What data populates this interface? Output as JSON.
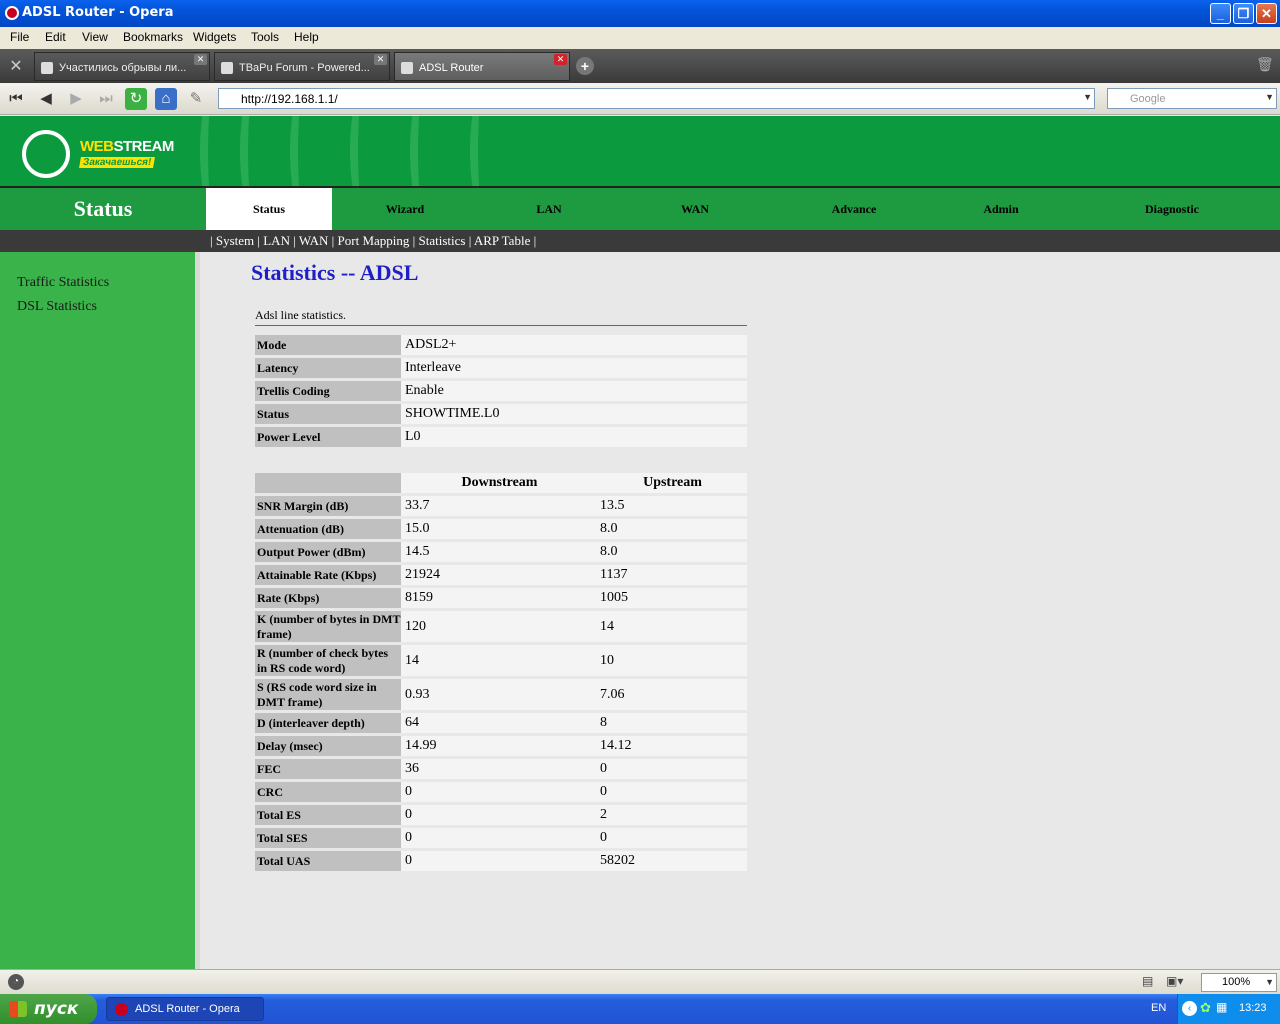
{
  "window": {
    "title": "ADSL Router - Opera"
  },
  "menu": [
    "File",
    "Edit",
    "View",
    "Bookmarks",
    "Widgets",
    "Tools",
    "Help"
  ],
  "tabs": [
    {
      "label": "Участились обрывы ли..."
    },
    {
      "label": "TBaPu Forum - Powered..."
    },
    {
      "label": "ADSL Router"
    }
  ],
  "address": {
    "url": "http://192.168.1.1/"
  },
  "search": {
    "placeholder": "Google"
  },
  "banner": {
    "brand_web": "WEB",
    "brand_stream": "STREAM",
    "slogan": "Закачаешься!"
  },
  "nav": {
    "section_title": "Status",
    "items": [
      "Status",
      "Wizard",
      "LAN",
      "WAN",
      "Advance",
      "Admin",
      "Diagnostic"
    ],
    "active": "Status"
  },
  "subnav": "| System | LAN | WAN | Port Mapping | Statistics | ARP Table |",
  "sidebar": [
    "Traffic Statistics",
    "DSL Statistics"
  ],
  "main": {
    "heading": "Statistics -- ADSL",
    "caption": "Adsl line statistics.",
    "summary": [
      {
        "label": "Mode",
        "value": "ADSL2+"
      },
      {
        "label": "Latency",
        "value": "Interleave"
      },
      {
        "label": "Trellis Coding",
        "value": "Enable"
      },
      {
        "label": "Status",
        "value": "SHOWTIME.L0"
      },
      {
        "label": "Power Level",
        "value": "L0"
      }
    ],
    "columns": [
      "Downstream",
      "Upstream"
    ],
    "rows": [
      {
        "label": "SNR Margin (dB)",
        "down": "33.7",
        "up": "13.5"
      },
      {
        "label": "Attenuation (dB)",
        "down": "15.0",
        "up": "8.0"
      },
      {
        "label": "Output Power (dBm)",
        "down": "14.5",
        "up": "8.0"
      },
      {
        "label": "Attainable Rate (Kbps)",
        "down": "21924",
        "up": "1137"
      },
      {
        "label": "Rate (Kbps)",
        "down": "8159",
        "up": "1005"
      },
      {
        "label": "K (number of bytes in DMT frame)",
        "down": "120",
        "up": "14"
      },
      {
        "label": "R (number of check bytes in RS code word)",
        "down": "14",
        "up": "10"
      },
      {
        "label": "S (RS code word size in DMT frame)",
        "down": "0.93",
        "up": "7.06"
      },
      {
        "label": "D (interleaver depth)",
        "down": "64",
        "up": "8"
      },
      {
        "label": "Delay (msec)",
        "down": "14.99",
        "up": "14.12"
      },
      {
        "label": "FEC",
        "down": "36",
        "up": "0"
      },
      {
        "label": "CRC",
        "down": "0",
        "up": "0"
      },
      {
        "label": "Total ES",
        "down": "0",
        "up": "2"
      },
      {
        "label": "Total SES",
        "down": "0",
        "up": "0"
      },
      {
        "label": "Total UAS",
        "down": "0",
        "up": "58202"
      }
    ]
  },
  "statusbar": {
    "zoom": "100%"
  },
  "taskbar": {
    "start": "пуск",
    "task": "ADSL Router - Opera",
    "lang": "EN",
    "clock": "13:23"
  },
  "colors": {
    "brand_green": "#0c9a3e",
    "heading_blue": "#1f1fc8",
    "sidebar_green": "#3ab44a"
  }
}
